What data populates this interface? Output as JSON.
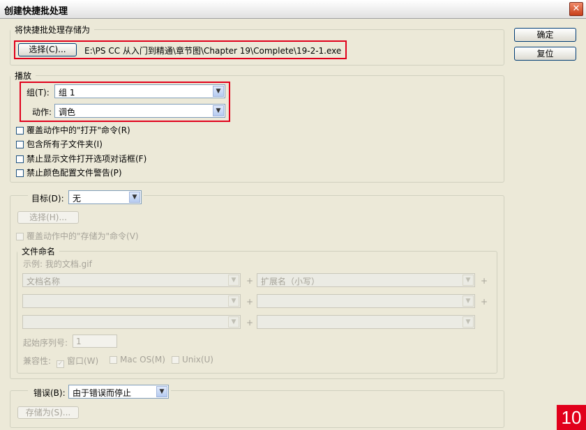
{
  "window": {
    "title": "创建快捷批处理"
  },
  "save_group": {
    "legend": "将快捷批处理存储为",
    "choose_label": "选择(C)...",
    "path": "E:\\PS CC 从入门到精通\\章节图\\Chapter 19\\Complete\\19-2-1.exe"
  },
  "side_buttons": {
    "ok": "确定",
    "reset": "复位"
  },
  "play_group": {
    "legend": "播放",
    "group_label": "组(T):",
    "group_value": "组 1",
    "action_label": "动作:",
    "action_value": "调色",
    "checks": [
      "覆盖动作中的\"打开\"命令(R)",
      "包含所有子文件夹(I)",
      "禁止显示文件打开选项对话框(F)",
      "禁止颜色配置文件警告(P)"
    ]
  },
  "target_group": {
    "label": "目标(D):",
    "value": "无",
    "choose_label": "选择(H)...",
    "override_save": "覆盖动作中的\"存储为\"命令(V)"
  },
  "naming_group": {
    "legend": "文件命名",
    "example": "示例: 我的文档.gif",
    "row1_left": "文档名称",
    "row1_right": "扩展名（小写）",
    "plus": "+",
    "serial_label": "起始序列号:",
    "serial_value": "1",
    "compat_label": "兼容性:",
    "compat_windows": "窗口(W)",
    "compat_mac": "Mac OS(M)",
    "compat_unix": "Unix(U)"
  },
  "error_group": {
    "label": "错误(B):",
    "value": "由于错误而停止",
    "save_as_label": "存储为(S)..."
  },
  "badge": "10"
}
